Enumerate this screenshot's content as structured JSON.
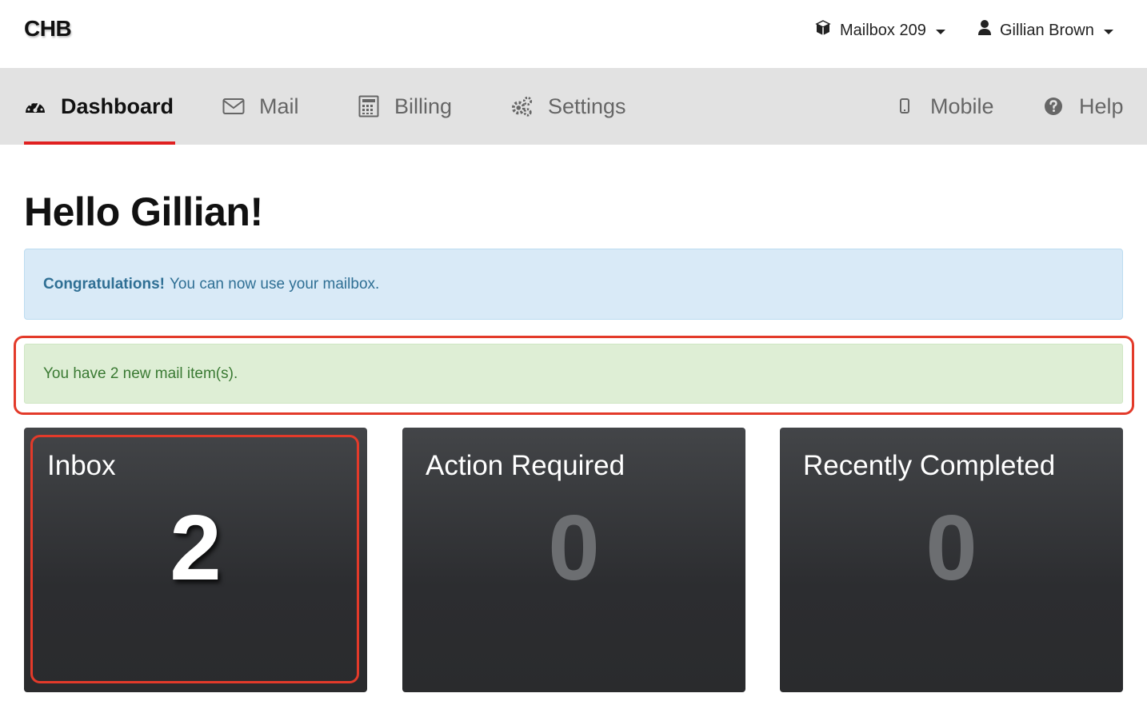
{
  "header": {
    "brand": "CHB",
    "mailbox_label": "Mailbox 209",
    "user_label": "Gillian Brown"
  },
  "nav": {
    "items": [
      {
        "label": "Dashboard",
        "icon": "dashboard-icon",
        "active": true
      },
      {
        "label": "Mail",
        "icon": "envelope-icon",
        "active": false
      },
      {
        "label": "Billing",
        "icon": "calculator-icon",
        "active": false
      },
      {
        "label": "Settings",
        "icon": "gears-icon",
        "active": false
      },
      {
        "label": "Mobile",
        "icon": "mobile-icon",
        "active": false
      },
      {
        "label": "Help",
        "icon": "question-circle-icon",
        "active": false
      }
    ]
  },
  "main": {
    "greeting": "Hello Gillian!",
    "info_alert": {
      "strong": "Congratulations!",
      "text": "You can now use your mailbox."
    },
    "success_alert": {
      "text": "You have 2 new mail item(s)."
    },
    "cards": [
      {
        "title": "Inbox",
        "count": "2"
      },
      {
        "title": "Action Required",
        "count": "0"
      },
      {
        "title": "Recently Completed",
        "count": "0"
      }
    ]
  },
  "colors": {
    "accent_red": "#e02020",
    "highlight_red": "#e33a2a",
    "info_bg": "#d9eaf7",
    "success_bg": "#deeed5",
    "card_bg": "#2c2d30"
  }
}
